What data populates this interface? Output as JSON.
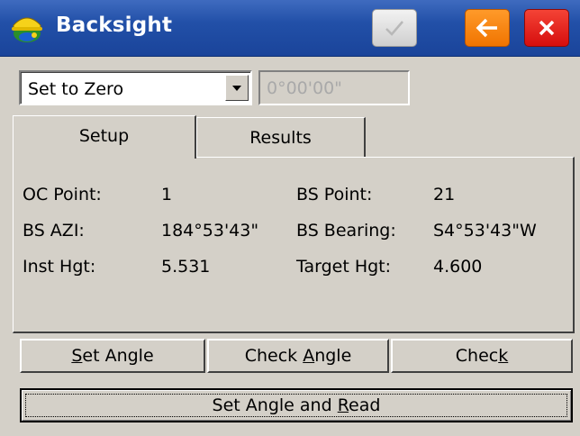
{
  "window": {
    "title": "Backsight"
  },
  "toolbar": {
    "ok_icon": "checkmark-icon",
    "back_icon": "arrow-left-icon",
    "close_icon": "close-icon"
  },
  "colors": {
    "titlebar": "#2250a8",
    "back_button": "#f07400",
    "close_button": "#d60e0e"
  },
  "mode": {
    "selected": "Set to Zero",
    "angle_value": "0°00'00\""
  },
  "tabs": [
    {
      "label": "Setup",
      "active": true
    },
    {
      "label": "Results",
      "active": false
    }
  ],
  "setup": {
    "oc_point_label": "OC Point:",
    "oc_point_value": "1",
    "bs_point_label": "BS Point:",
    "bs_point_value": "21",
    "bs_azi_label": "BS AZI:",
    "bs_azi_value": "184°53'43\"",
    "bs_bearing_label": "BS Bearing:",
    "bs_bearing_value": "S4°53'43\"W",
    "inst_hgt_label": "Inst Hgt:",
    "inst_hgt_value": "5.531",
    "target_hgt_label": "Target Hgt:",
    "target_hgt_value": "4.600"
  },
  "buttons": {
    "set_angle": {
      "prefix": "",
      "mnemonic": "S",
      "suffix": "et Angle"
    },
    "check_angle": {
      "prefix": "Check ",
      "mnemonic": "A",
      "suffix": "ngle"
    },
    "check": {
      "prefix": "Chec",
      "mnemonic": "k",
      "suffix": ""
    },
    "set_angle_read": {
      "prefix": "Set Angle and ",
      "mnemonic": "R",
      "suffix": "ead"
    }
  }
}
